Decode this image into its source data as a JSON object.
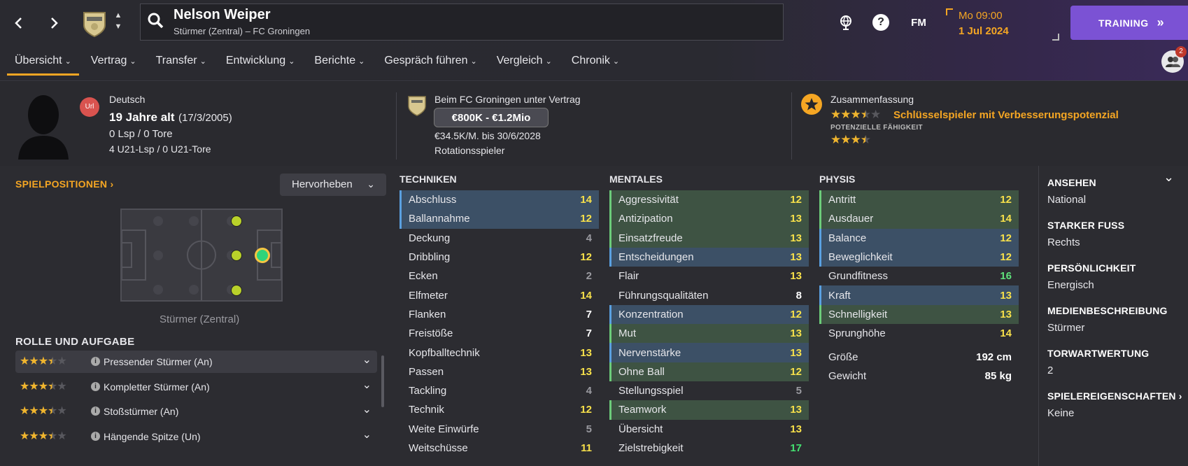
{
  "header": {
    "player_name": "Nelson Weiper",
    "player_sub": "Stürmer (Zentral) – FC Groningen",
    "date_line1": "Mo 09:00",
    "date_line2": "1 Jul 2024",
    "training_label": "TRAINING",
    "fm_label": "FM",
    "help_label": "?",
    "notification_count": "2"
  },
  "tabs": [
    {
      "label": "Übersicht"
    },
    {
      "label": "Vertrag"
    },
    {
      "label": "Transfer"
    },
    {
      "label": "Entwicklung"
    },
    {
      "label": "Berichte"
    },
    {
      "label": "Gespräch führen"
    },
    {
      "label": "Vergleich"
    },
    {
      "label": "Chronik"
    }
  ],
  "profile": {
    "flag_label": "Url",
    "nationality": "Deutsch",
    "age": "19 Jahre alt",
    "birthdate": "(17/3/2005)",
    "caps": "0 Lsp / 0 Tore",
    "u21": "4 U21-Lsp / 0 U21-Tore"
  },
  "contract": {
    "club_line": "Beim FC Groningen unter Vertrag",
    "value": "€800K - €1.2Mio",
    "wage": "€34.5K/M. bis 30/6/2028",
    "status": "Rotationsspieler"
  },
  "summary": {
    "title": "Zusammenfassung",
    "current_stars": 3.5,
    "headline": "Schlüsselspieler mit Verbesserungspotenzial",
    "potential_label": "POTENZIELLE FÄHIGKEIT",
    "potential_stars": 3.5
  },
  "positions": {
    "title": "SPIELPOSITIONEN",
    "highlight_label": "Hervorheben",
    "position_caption": "Stürmer (Zentral)",
    "role_title": "ROLLE UND AUFGABE"
  },
  "roles": [
    {
      "stars": 3.5,
      "label": "Pressender Stürmer (An)"
    },
    {
      "stars": 3.5,
      "label": "Kompletter Stürmer (An)"
    },
    {
      "stars": 3.5,
      "label": "Stoßstürmer (An)"
    },
    {
      "stars": 3.5,
      "label": "Hängende Spitze (Un)"
    }
  ],
  "attributes": {
    "technical_title": "TECHNIKEN",
    "mental_title": "MENTALES",
    "physical_title": "PHYSIS",
    "technical": [
      {
        "name": "Abschluss",
        "value": "14",
        "hl": "b"
      },
      {
        "name": "Ballannahme",
        "value": "12",
        "hl": "b"
      },
      {
        "name": "Deckung",
        "value": "4",
        "hl": ""
      },
      {
        "name": "Dribbling",
        "value": "12",
        "hl": ""
      },
      {
        "name": "Ecken",
        "value": "2",
        "hl": ""
      },
      {
        "name": "Elfmeter",
        "value": "14",
        "hl": ""
      },
      {
        "name": "Flanken",
        "value": "7",
        "hl": ""
      },
      {
        "name": "Freistöße",
        "value": "7",
        "hl": ""
      },
      {
        "name": "Kopfballtechnik",
        "value": "13",
        "hl": ""
      },
      {
        "name": "Passen",
        "value": "13",
        "hl": ""
      },
      {
        "name": "Tackling",
        "value": "4",
        "hl": ""
      },
      {
        "name": "Technik",
        "value": "12",
        "hl": ""
      },
      {
        "name": "Weite Einwürfe",
        "value": "5",
        "hl": ""
      },
      {
        "name": "Weitschüsse",
        "value": "11",
        "hl": ""
      }
    ],
    "mental": [
      {
        "name": "Aggressivität",
        "value": "12",
        "hl": "g"
      },
      {
        "name": "Antizipation",
        "value": "13",
        "hl": "g"
      },
      {
        "name": "Einsatzfreude",
        "value": "13",
        "hl": "g"
      },
      {
        "name": "Entscheidungen",
        "value": "13",
        "hl": "b"
      },
      {
        "name": "Flair",
        "value": "13",
        "hl": ""
      },
      {
        "name": "Führungsqualitäten",
        "value": "8",
        "hl": ""
      },
      {
        "name": "Konzentration",
        "value": "12",
        "hl": "b"
      },
      {
        "name": "Mut",
        "value": "13",
        "hl": "g"
      },
      {
        "name": "Nervenstärke",
        "value": "13",
        "hl": "b"
      },
      {
        "name": "Ohne Ball",
        "value": "12",
        "hl": "g"
      },
      {
        "name": "Stellungsspiel",
        "value": "5",
        "hl": ""
      },
      {
        "name": "Teamwork",
        "value": "13",
        "hl": "g"
      },
      {
        "name": "Übersicht",
        "value": "13",
        "hl": ""
      },
      {
        "name": "Zielstrebigkeit",
        "value": "17",
        "hl": ""
      }
    ],
    "physical": [
      {
        "name": "Antritt",
        "value": "12",
        "hl": "g"
      },
      {
        "name": "Ausdauer",
        "value": "14",
        "hl": "g"
      },
      {
        "name": "Balance",
        "value": "12",
        "hl": "b"
      },
      {
        "name": "Beweglichkeit",
        "value": "12",
        "hl": "b"
      },
      {
        "name": "Grundfitness",
        "value": "16",
        "hl": ""
      },
      {
        "name": "Kraft",
        "value": "13",
        "hl": "b"
      },
      {
        "name": "Schnelligkeit",
        "value": "13",
        "hl": "g"
      },
      {
        "name": "Sprunghöhe",
        "value": "14",
        "hl": ""
      }
    ],
    "height_label": "Größe",
    "height_value": "192 cm",
    "weight_label": "Gewicht",
    "weight_value": "85 kg"
  },
  "info": [
    {
      "title": "ANSEHEN",
      "value": "National"
    },
    {
      "title": "STARKER FUSS",
      "value": "Rechts"
    },
    {
      "title": "PERSÖNLICHKEIT",
      "value": "Energisch"
    },
    {
      "title": "MEDIENBESCHREIBUNG",
      "value": "Stürmer"
    },
    {
      "title": "TORWARTWERTUNG",
      "value": "2"
    },
    {
      "title": "SPIELEREIGENSCHAFTEN",
      "value": "Keine"
    }
  ],
  "colors": {
    "accent": "#f5a623",
    "training": "#7b52d4"
  }
}
